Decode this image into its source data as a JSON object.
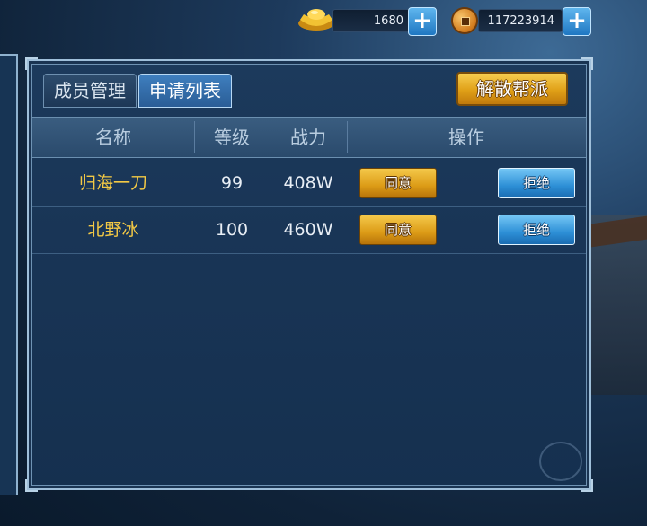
{
  "resources": {
    "gold_ingot": {
      "icon": "gold-ingot-icon",
      "value": "1680"
    },
    "copper_coin": {
      "icon": "copper-coin-icon",
      "value": "117223914"
    },
    "add_label": "+"
  },
  "tabs": [
    {
      "label": "成员管理",
      "active": false
    },
    {
      "label": "申请列表",
      "active": true
    }
  ],
  "disband_label": "解散帮派",
  "table": {
    "headers": [
      "名称",
      "等级",
      "战力",
      "操作"
    ],
    "rows": [
      {
        "name": "归海一刀",
        "level": "99",
        "power": "408W",
        "agree": "同意",
        "reject": "拒绝"
      },
      {
        "name": "北野冰",
        "level": "100",
        "power": "460W",
        "agree": "同意",
        "reject": "拒绝"
      }
    ]
  },
  "colors": {
    "name_text": "#f3c945",
    "agree_button": "#e0a017",
    "reject_button": "#2d8fd6",
    "active_tab": "#3f7fbf"
  }
}
